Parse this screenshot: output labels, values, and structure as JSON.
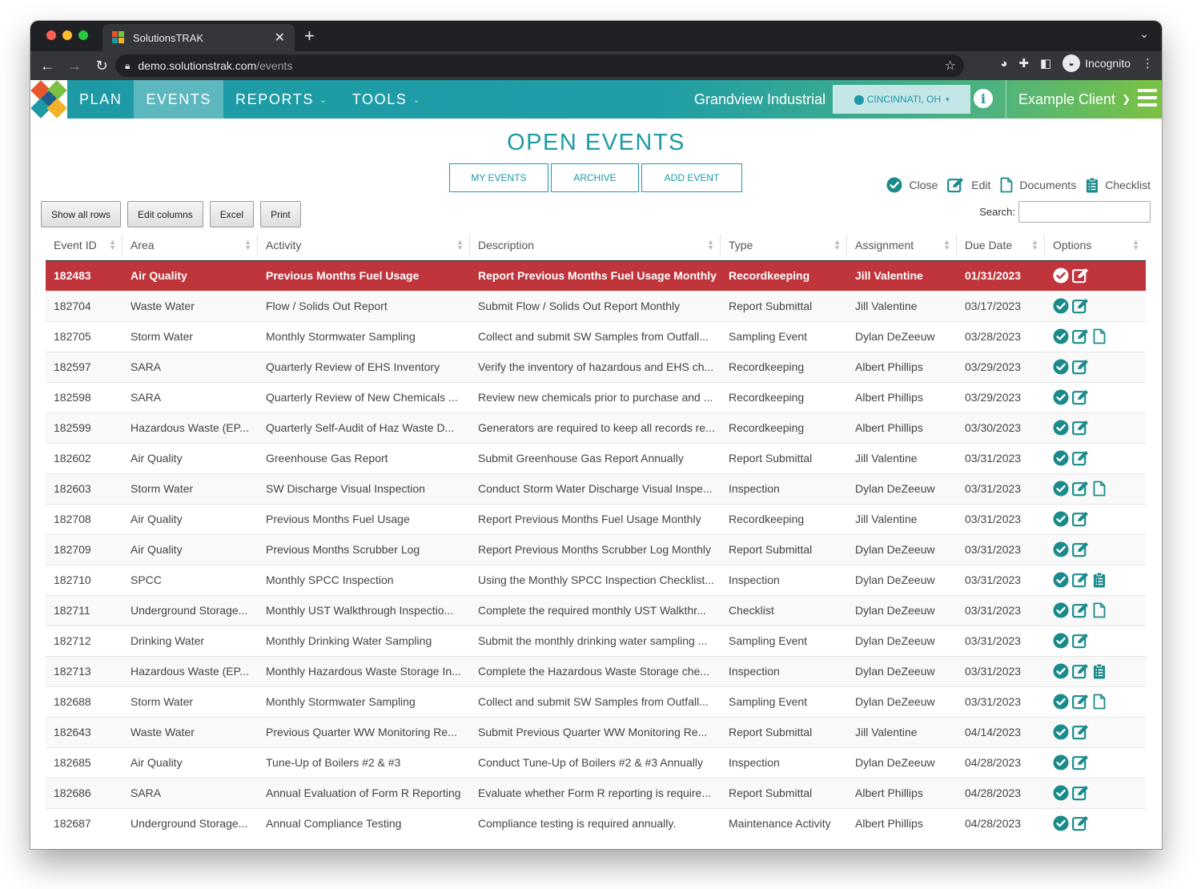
{
  "browser": {
    "tab_title": "SolutionsTRAK",
    "tab_close": "✕",
    "new_tab": "+",
    "url_host": "demo.solutionstrak.com",
    "url_path": "/events",
    "profile_label": "Incognito"
  },
  "nav": {
    "items": [
      {
        "label": "PLAN",
        "active": false,
        "dropdown": false
      },
      {
        "label": "EVENTS",
        "active": true,
        "dropdown": false
      },
      {
        "label": "REPORTS",
        "active": false,
        "dropdown": true
      },
      {
        "label": "TOOLS",
        "active": false,
        "dropdown": true
      }
    ],
    "company": "Grandview Industrial",
    "location": "CINCINNATI, OH",
    "client": "Example Client"
  },
  "page": {
    "title": "OPEN EVENTS",
    "tabs": [
      "MY EVENTS",
      "ARCHIVE",
      "ADD EVENT"
    ],
    "legend": [
      "Close",
      "Edit",
      "Documents",
      "Checklist"
    ],
    "buttons": [
      "Show all rows",
      "Edit columns",
      "Excel",
      "Print"
    ],
    "search_label": "Search:"
  },
  "colors": {
    "primary": "#1e9aa5",
    "highlight_row": "#c0343c",
    "icon_green": "#1a8a8a"
  },
  "table": {
    "columns": [
      "Event ID",
      "Area",
      "Activity",
      "Description",
      "Type",
      "Assignment",
      "Due Date",
      "Options"
    ],
    "rows": [
      {
        "id": "182483",
        "area": "Air Quality",
        "activity": "Previous Months Fuel Usage",
        "description": "Report Previous Months Fuel Usage Monthly",
        "type": "Recordkeeping",
        "assignment": "Jill Valentine",
        "due": "01/31/2023",
        "options": [
          "close",
          "edit"
        ],
        "highlight": true
      },
      {
        "id": "182704",
        "area": "Waste Water",
        "activity": "Flow / Solids Out Report",
        "description": "Submit Flow / Solids Out Report Monthly",
        "type": "Report Submittal",
        "assignment": "Jill Valentine",
        "due": "03/17/2023",
        "options": [
          "close",
          "edit"
        ]
      },
      {
        "id": "182705",
        "area": "Storm Water",
        "activity": "Monthly Stormwater Sampling",
        "description": "Collect and submit SW Samples from Outfall...",
        "type": "Sampling Event",
        "assignment": "Dylan DeZeeuw",
        "due": "03/28/2023",
        "options": [
          "close",
          "edit",
          "document"
        ]
      },
      {
        "id": "182597",
        "area": "SARA",
        "activity": "Quarterly Review of EHS Inventory",
        "description": "Verify the inventory of hazardous and EHS ch...",
        "type": "Recordkeeping",
        "assignment": "Albert Phillips",
        "due": "03/29/2023",
        "options": [
          "close",
          "edit"
        ]
      },
      {
        "id": "182598",
        "area": "SARA",
        "activity": "Quarterly Review of New Chemicals ...",
        "description": "Review new chemicals prior to purchase and ...",
        "type": "Recordkeeping",
        "assignment": "Albert Phillips",
        "due": "03/29/2023",
        "options": [
          "close",
          "edit"
        ]
      },
      {
        "id": "182599",
        "area": "Hazardous Waste (EP...",
        "activity": "Quarterly Self-Audit of Haz Waste D...",
        "description": "Generators are required to keep all records re...",
        "type": "Recordkeeping",
        "assignment": "Albert Phillips",
        "due": "03/30/2023",
        "options": [
          "close",
          "edit"
        ]
      },
      {
        "id": "182602",
        "area": "Air Quality",
        "activity": "Greenhouse Gas Report",
        "description": "Submit Greenhouse Gas Report Annually",
        "type": "Report Submittal",
        "assignment": "Jill Valentine",
        "due": "03/31/2023",
        "options": [
          "close",
          "edit"
        ]
      },
      {
        "id": "182603",
        "area": "Storm Water",
        "activity": "SW Discharge Visual Inspection",
        "description": "Conduct Storm Water Discharge Visual Inspe...",
        "type": "Inspection",
        "assignment": "Dylan DeZeeuw",
        "due": "03/31/2023",
        "options": [
          "close",
          "edit",
          "document"
        ]
      },
      {
        "id": "182708",
        "area": "Air Quality",
        "activity": "Previous Months Fuel Usage",
        "description": "Report Previous Months Fuel Usage Monthly",
        "type": "Recordkeeping",
        "assignment": "Jill Valentine",
        "due": "03/31/2023",
        "options": [
          "close",
          "edit"
        ]
      },
      {
        "id": "182709",
        "area": "Air Quality",
        "activity": "Previous Months Scrubber Log",
        "description": "Report Previous Months Scrubber Log Monthly",
        "type": "Report Submittal",
        "assignment": "Dylan DeZeeuw",
        "due": "03/31/2023",
        "options": [
          "close",
          "edit"
        ]
      },
      {
        "id": "182710",
        "area": "SPCC",
        "activity": "Monthly SPCC Inspection",
        "description": "Using the Monthly SPCC Inspection Checklist...",
        "type": "Inspection",
        "assignment": "Dylan DeZeeuw",
        "due": "03/31/2023",
        "options": [
          "close",
          "edit",
          "checklist"
        ]
      },
      {
        "id": "182711",
        "area": "Underground Storage...",
        "activity": "Monthly UST Walkthrough Inspectio...",
        "description": "Complete the required monthly UST Walkthr...",
        "type": "Checklist",
        "assignment": "Dylan DeZeeuw",
        "due": "03/31/2023",
        "options": [
          "close",
          "edit",
          "document"
        ]
      },
      {
        "id": "182712",
        "area": "Drinking Water",
        "activity": "Monthly Drinking Water Sampling",
        "description": "Submit the monthly drinking water sampling ...",
        "type": "Sampling Event",
        "assignment": "Dylan DeZeeuw",
        "due": "03/31/2023",
        "options": [
          "close",
          "edit"
        ]
      },
      {
        "id": "182713",
        "area": "Hazardous Waste (EP...",
        "activity": "Monthly Hazardous Waste Storage In...",
        "description": "Complete the Hazardous Waste Storage che...",
        "type": "Inspection",
        "assignment": "Dylan DeZeeuw",
        "due": "03/31/2023",
        "options": [
          "close",
          "edit",
          "checklist"
        ]
      },
      {
        "id": "182688",
        "area": "Storm Water",
        "activity": "Monthly Stormwater Sampling",
        "description": "Collect and submit SW Samples from Outfall...",
        "type": "Sampling Event",
        "assignment": "Dylan DeZeeuw",
        "due": "03/31/2023",
        "options": [
          "close",
          "edit",
          "document"
        ]
      },
      {
        "id": "182643",
        "area": "Waste Water",
        "activity": "Previous Quarter WW Monitoring Re...",
        "description": "Submit Previous Quarter WW Monitoring Re...",
        "type": "Report Submittal",
        "assignment": "Jill Valentine",
        "due": "04/14/2023",
        "options": [
          "close",
          "edit"
        ]
      },
      {
        "id": "182685",
        "area": "Air Quality",
        "activity": "Tune-Up of Boilers #2 & #3",
        "description": "Conduct Tune-Up of Boilers #2 & #3 Annually",
        "type": "Inspection",
        "assignment": "Dylan DeZeeuw",
        "due": "04/28/2023",
        "options": [
          "close",
          "edit"
        ]
      },
      {
        "id": "182686",
        "area": "SARA",
        "activity": "Annual Evaluation of Form R Reporting",
        "description": "Evaluate whether Form R reporting is require...",
        "type": "Report Submittal",
        "assignment": "Albert Phillips",
        "due": "04/28/2023",
        "options": [
          "close",
          "edit"
        ]
      },
      {
        "id": "182687",
        "area": "Underground Storage...",
        "activity": "Annual Compliance Testing",
        "description": "Compliance testing is required annually.",
        "type": "Maintenance Activity",
        "assignment": "Albert Phillips",
        "due": "04/28/2023",
        "options": [
          "close",
          "edit"
        ]
      }
    ]
  }
}
